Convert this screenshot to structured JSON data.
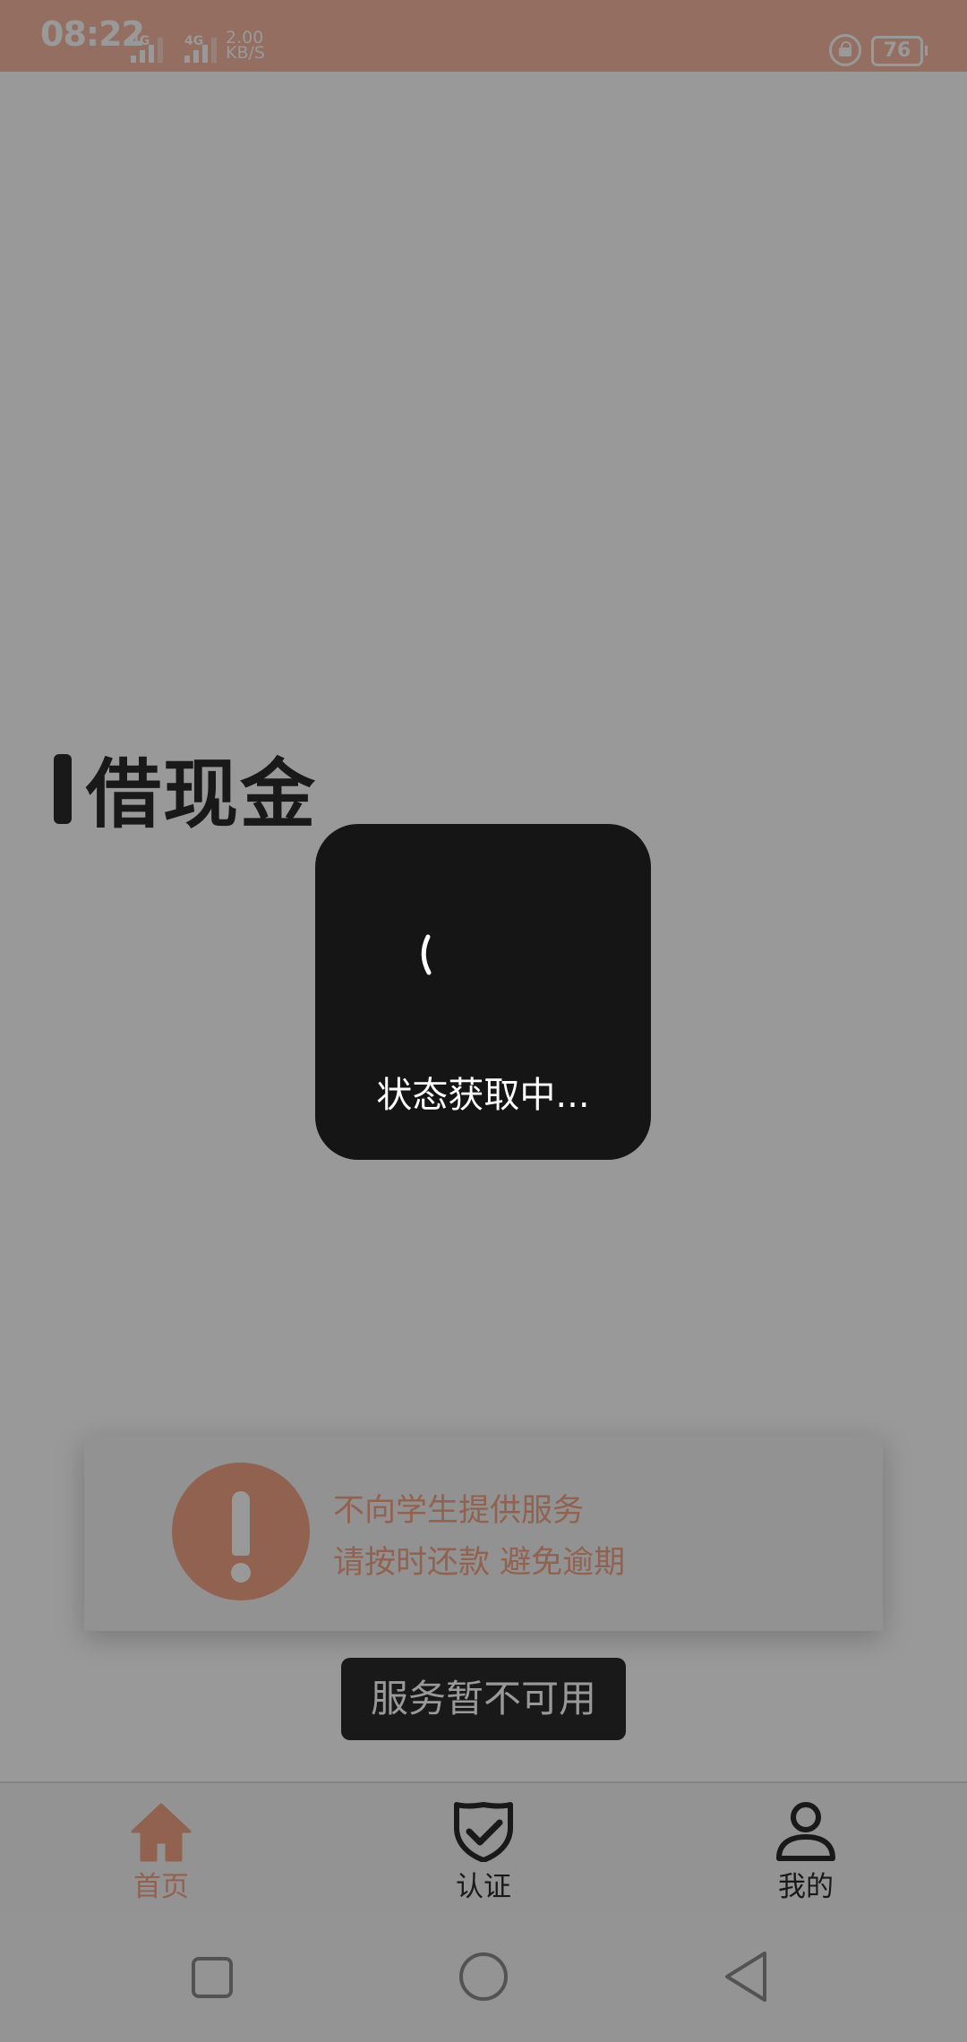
{
  "status_bar": {
    "time": "08:22",
    "signal1_label": "4G",
    "signal2_label": "4G",
    "speed_value": "2.00",
    "speed_unit": "KB/S",
    "battery": "76"
  },
  "main": {
    "heading": "借现金",
    "notice": {
      "line1": "不向学生提供服务",
      "line2": "请按时还款 避免逾期"
    },
    "toast": "服务暂不可用"
  },
  "loading_dialog": {
    "text": "状态获取中..."
  },
  "bottom_nav": {
    "items": [
      {
        "label": "首页",
        "icon": "home-icon",
        "active": true
      },
      {
        "label": "认证",
        "icon": "shield-check-icon",
        "active": false
      },
      {
        "label": "我的",
        "icon": "person-icon",
        "active": false
      }
    ]
  },
  "colors": {
    "accent": "#f2a386",
    "status_bar": "#f7b7a0",
    "dark_text": "#2b2b2b",
    "dialog_bg": "#151515"
  },
  "system_nav": {
    "buttons": [
      "recent-apps-icon",
      "home-circle-icon",
      "back-triangle-icon"
    ]
  }
}
